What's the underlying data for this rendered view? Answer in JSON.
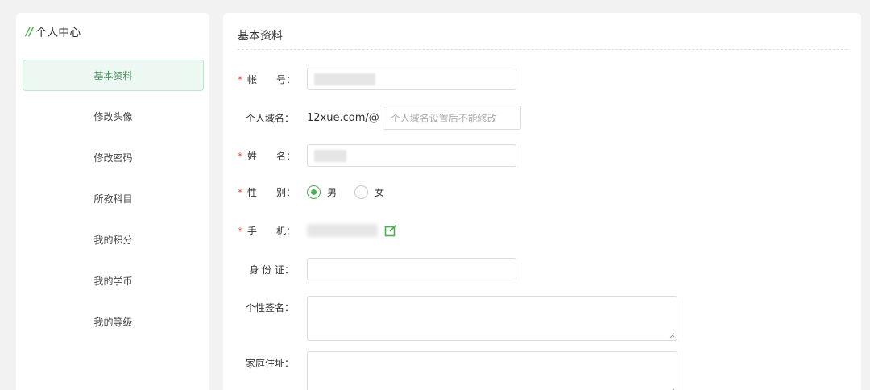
{
  "sidebar": {
    "title": "个人中心",
    "title_mark": "//",
    "items": [
      {
        "label": "基本资料",
        "active": true
      },
      {
        "label": "修改头像",
        "active": false
      },
      {
        "label": "修改密码",
        "active": false
      },
      {
        "label": "所教科目",
        "active": false
      },
      {
        "label": "我的积分",
        "active": false
      },
      {
        "label": "我的学币",
        "active": false
      },
      {
        "label": "我的等级",
        "active": false
      }
    ]
  },
  "panel": {
    "title": "基本资料",
    "fields": {
      "account_label": "帐　　号：",
      "domain_label": "个人域名：",
      "domain_prefix": "12xue.com/@",
      "domain_placeholder": "个人域名设置后不能修改",
      "name_label": "姓　　名：",
      "gender_label": "性　　别：",
      "gender_options": [
        "男",
        "女"
      ],
      "gender_selected": "男",
      "phone_label": "手　　机：",
      "id_label": "身 份 证：",
      "signature_label": "个性签名：",
      "address_label": "家庭住址：",
      "required_mark": "*"
    }
  },
  "colors": {
    "accent": "#4caf50",
    "required": "#e74c3c",
    "active_bg": "#ecf8f1"
  }
}
